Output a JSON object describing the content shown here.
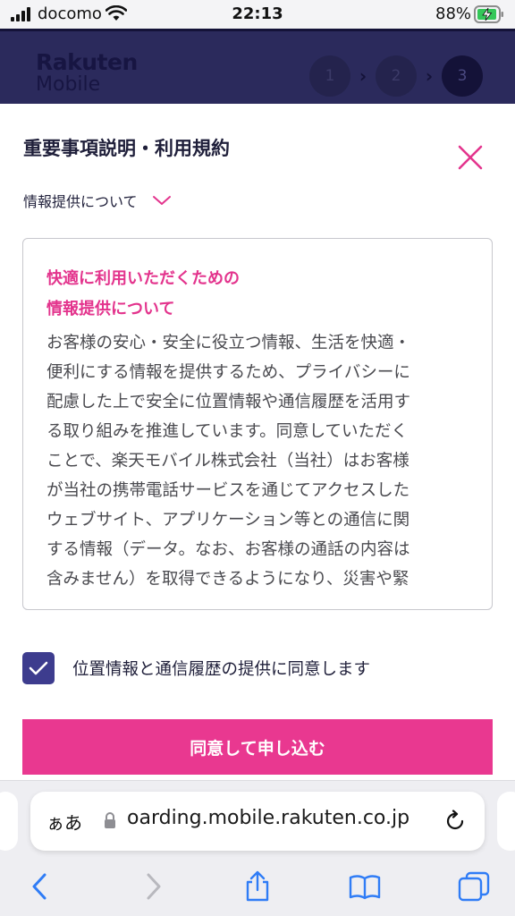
{
  "status_bar": {
    "carrier": "docomo",
    "time": "22:13",
    "battery_percent": "88%",
    "icons": [
      "signal-icon",
      "wifi-icon",
      "battery-charging-icon"
    ]
  },
  "header": {
    "logo_line1": "Rakuten",
    "logo_line2": "Mobile",
    "steps": [
      "1",
      "2",
      "3"
    ],
    "active_step": "3"
  },
  "modal": {
    "title": "重要事項説明・利用規約",
    "section_label": "情報提供について",
    "terms_heading_line1": "快適に利用いただくための",
    "terms_heading_line2": "情報提供について",
    "terms_lines": [
      "お客様の安心・安全に役立つ情報、生活を快適・",
      "便利にする情報を提供するため、プライバシーに",
      "配慮した上で安全に位置情報や通信履歴を活用す",
      "る取り組みを推進しています。同意していただく",
      "ことで、楽天モバイル株式会社（当社）はお客様",
      "が当社の携帯電話サービスを通じてアクセスした",
      "ウェブサイト、アプリケーション等との通信に関",
      "する情報（データ。なお、お客様の通話の内容は",
      "含みません）を取得できるようになり、災害や緊"
    ],
    "consent_label": "位置情報と通信履歴の提供に同意します",
    "consent_checked": true,
    "apply_button": "同意して申し込む"
  },
  "safari": {
    "text_size_label": "ぁあ",
    "url": "oarding.mobile.rakuten.co.jp",
    "toolbar": [
      "back-icon",
      "forward-icon",
      "share-icon",
      "bookmarks-icon",
      "tabs-icon"
    ]
  },
  "colors": {
    "accent_pink": "#e93890",
    "header_navy": "#2b2a5c",
    "checkbox_indigo": "#3d3c8e",
    "link_blue": "#2f7cf6"
  }
}
